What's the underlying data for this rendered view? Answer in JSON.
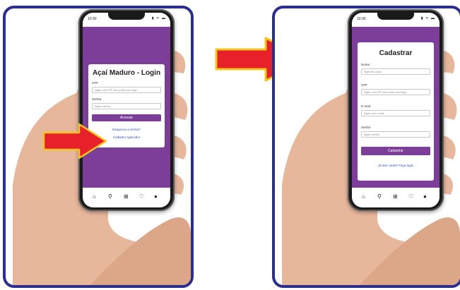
{
  "left_phone": {
    "status": {
      "time": "10:30",
      "icons": "▮ ᯤ ▬"
    },
    "login": {
      "title": "Açaí Maduro - Login",
      "cpf_label": "CPF",
      "cpf_placeholder": "Digite o seu CPF sem pontos nem traço",
      "senha_label": "Senha",
      "senha_placeholder": "Digite a senha",
      "submit_label": "Acessar",
      "forgot_link": "Esqueceu a senha?",
      "register_link": "Cadastro Agricultor"
    }
  },
  "right_phone": {
    "status": {
      "time": "10:30",
      "icons": "▮ ᯤ ▬"
    },
    "register": {
      "title": "Cadastrar",
      "nome_label": "Nome:",
      "nome_placeholder": "Digite seu nome",
      "cpf_label": "CPF",
      "cpf_placeholder": "Digite o seu CPF sem pontos nem traço",
      "email_label": "E-mail:",
      "email_placeholder": "Digite o seu e-mail",
      "senha_label": "Senha",
      "senha_placeholder": "Digite a senha",
      "submit_label": "Cadastrar",
      "login_link": "Já tem conta? Faça login"
    }
  },
  "bottom_nav": [
    "home-icon",
    "search-icon",
    "add-icon",
    "heart-icon",
    "profile-icon"
  ],
  "colors": {
    "accent": "#7d3e99",
    "frame": "#2b2e8c",
    "arrow": "#e8202a",
    "arrow_outline": "#f2c61f"
  }
}
